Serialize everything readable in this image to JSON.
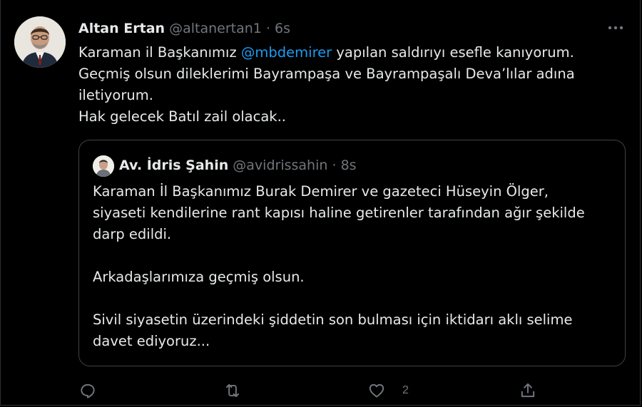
{
  "tweet": {
    "author_name": "Altan Ertan",
    "author_handle": "@altanertan1",
    "separator": "·",
    "time": "6s",
    "lines": [
      {
        "before": "Karaman il Başkanımız ",
        "mention": "@mbdemirer",
        "after": " yapılan saldırıyı esefle kanıyorum."
      },
      {
        "text": "Geçmiş olsun dileklerimi Bayrampaşa ve Bayrampaşalı Deva’lılar adına"
      },
      {
        "text": "iletiyorum."
      },
      {
        "text": "Hak gelecek Batıl zail olacak.."
      }
    ]
  },
  "quote": {
    "author_name": "Av. İdris Şahin",
    "author_handle": "@avidrissahin",
    "separator": "·",
    "time": "8s",
    "paragraph1": [
      "Karaman İl Başkanımız Burak Demirer ve gazeteci Hüseyin Ölger,",
      "siyaseti kendilerine rant kapısı haline getirenler tarafından ağır şekilde",
      "darp edildi."
    ],
    "paragraph2": [
      "Arkadaşlarımıza geçmiş olsun."
    ],
    "paragraph3": [
      "Sivil siyasetin üzerindeki şiddetin son bulması için iktidarı aklı selime",
      "davet ediyoruz..."
    ]
  },
  "actions": {
    "reply_icon": "reply-icon",
    "retweet_icon": "retweet-icon",
    "like_icon": "heart-icon",
    "like_count": "2",
    "share_icon": "share-icon"
  },
  "colors": {
    "background": "#000000",
    "text": "#e7e9ea",
    "secondary": "#71767b",
    "mention": "#1d9bf0",
    "border": "#3e4144"
  }
}
